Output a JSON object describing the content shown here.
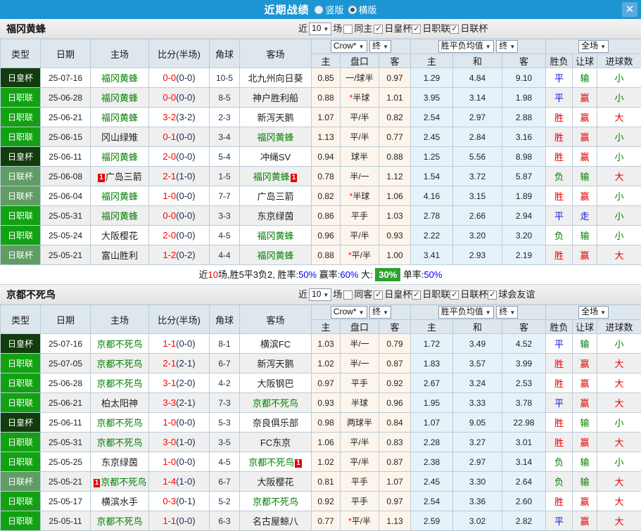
{
  "titlebar": {
    "title": "近期战绩",
    "radio_options": [
      {
        "label": "竖版",
        "selected": false
      },
      {
        "label": "横版",
        "selected": true
      }
    ],
    "close_label": "✕"
  },
  "columns": {
    "main": [
      "类型",
      "日期",
      "主场",
      "比分(半场)",
      "角球",
      "客场"
    ],
    "sub": [
      "主",
      "盘口",
      "客",
      "主",
      "和",
      "客",
      "胜负",
      "让球",
      "进球数"
    ]
  },
  "colors": {
    "type_bg": {
      "日皇杯": "#133c0e",
      "日职联": "#13a113",
      "日联杯": "#619c64"
    },
    "outcome": {
      "胜": "#e60000",
      "平": "#1414dd",
      "负": "#008000",
      "赢": "#e60000",
      "走": "#1414dd",
      "输": "#008000",
      "大": "#e60000",
      "小": "#008000"
    },
    "team_green": "#008000"
  },
  "sections": [
    {
      "team": "福冈黄蜂",
      "filter": {
        "prefix": "近",
        "count": "10",
        "suffix": "场",
        "scope": {
          "label": "同主",
          "checked": false
        },
        "leagues": [
          {
            "label": "日皇杯",
            "checked": true
          },
          {
            "label": "日职联",
            "checked": true
          },
          {
            "label": "日联杯",
            "checked": true
          }
        ]
      },
      "dropdowns": {
        "odds_source": "Crow*",
        "odds_state": "终",
        "avg_label": "胜平负均值",
        "avg_state": "终",
        "period": "全场"
      },
      "rows": [
        {
          "type": "日皇杯",
          "date": "25-07-16",
          "home": "福冈黄蜂",
          "home_badge": "",
          "score": "0-0",
          "half": "(0-0)",
          "corners": "10-5",
          "away": "北九州向日葵",
          "away_badge": "",
          "home_odds": "0.85",
          "handicap": "一/球半",
          "away_odds": "0.97",
          "avg_home": "1.29",
          "avg_draw": "4.84",
          "avg_away": "9.10",
          "result": "平",
          "handicap_result": "输",
          "goals": "小"
        },
        {
          "type": "日职联",
          "date": "25-06-28",
          "home": "福冈黄蜂",
          "home_badge": "",
          "score": "0-0",
          "half": "(0-0)",
          "corners": "8-5",
          "away": "神户胜利船",
          "away_badge": "",
          "home_odds": "0.88",
          "handicap": "*半球",
          "away_odds": "1.01",
          "avg_home": "3.95",
          "avg_draw": "3.14",
          "avg_away": "1.98",
          "result": "平",
          "handicap_result": "赢",
          "goals": "小"
        },
        {
          "type": "日职联",
          "date": "25-06-21",
          "home": "福冈黄蜂",
          "home_badge": "",
          "score": "3-2",
          "half": "(3-2)",
          "corners": "2-3",
          "away": "新泻天鹅",
          "away_badge": "",
          "home_odds": "1.07",
          "handicap": "平/半",
          "away_odds": "0.82",
          "avg_home": "2.54",
          "avg_draw": "2.97",
          "avg_away": "2.88",
          "result": "胜",
          "handicap_result": "赢",
          "goals": "大"
        },
        {
          "type": "日职联",
          "date": "25-06-15",
          "home": "冈山绿雉",
          "home_badge": "",
          "score": "0-1",
          "half": "(0-0)",
          "corners": "3-4",
          "away": "福冈黄蜂",
          "away_badge": "",
          "home_odds": "1.13",
          "handicap": "平/半",
          "away_odds": "0.77",
          "avg_home": "2.45",
          "avg_draw": "2.84",
          "avg_away": "3.16",
          "result": "胜",
          "handicap_result": "赢",
          "goals": "小"
        },
        {
          "type": "日皇杯",
          "date": "25-06-11",
          "home": "福冈黄蜂",
          "home_badge": "",
          "score": "2-0",
          "half": "(0-0)",
          "corners": "5-4",
          "away": "冲绳SV",
          "away_badge": "",
          "home_odds": "0.94",
          "handicap": "球半",
          "away_odds": "0.88",
          "avg_home": "1.25",
          "avg_draw": "5.56",
          "avg_away": "8.98",
          "result": "胜",
          "handicap_result": "赢",
          "goals": "小"
        },
        {
          "type": "日联杯",
          "date": "25-06-08",
          "home": "广岛三箭",
          "home_badge": "1",
          "score": "2-1",
          "half": "(1-0)",
          "corners": "1-5",
          "away": "福冈黄蜂",
          "away_badge": "1",
          "home_odds": "0.78",
          "handicap": "半/一",
          "away_odds": "1.12",
          "avg_home": "1.54",
          "avg_draw": "3.72",
          "avg_away": "5.87",
          "result": "负",
          "handicap_result": "输",
          "goals": "大"
        },
        {
          "type": "日联杯",
          "date": "25-06-04",
          "home": "福冈黄蜂",
          "home_badge": "",
          "score": "1-0",
          "half": "(0-0)",
          "corners": "7-7",
          "away": "广岛三箭",
          "away_badge": "",
          "home_odds": "0.82",
          "handicap": "*半球",
          "away_odds": "1.06",
          "avg_home": "4.16",
          "avg_draw": "3.15",
          "avg_away": "1.89",
          "result": "胜",
          "handicap_result": "赢",
          "goals": "小"
        },
        {
          "type": "日职联",
          "date": "25-05-31",
          "home": "福冈黄蜂",
          "home_badge": "",
          "score": "0-0",
          "half": "(0-0)",
          "corners": "3-3",
          "away": "东京绿茵",
          "away_badge": "",
          "home_odds": "0.86",
          "handicap": "平手",
          "away_odds": "1.03",
          "avg_home": "2.78",
          "avg_draw": "2.66",
          "avg_away": "2.94",
          "result": "平",
          "handicap_result": "走",
          "goals": "小"
        },
        {
          "type": "日职联",
          "date": "25-05-24",
          "home": "大阪樱花",
          "home_badge": "",
          "score": "2-0",
          "half": "(0-0)",
          "corners": "4-5",
          "away": "福冈黄蜂",
          "away_badge": "",
          "home_odds": "0.96",
          "handicap": "平/半",
          "away_odds": "0.93",
          "avg_home": "2.22",
          "avg_draw": "3.20",
          "avg_away": "3.20",
          "result": "负",
          "handicap_result": "输",
          "goals": "小"
        },
        {
          "type": "日联杯",
          "date": "25-05-21",
          "home": "富山胜利",
          "home_badge": "",
          "score": "1-2",
          "half": "(0-2)",
          "corners": "4-4",
          "away": "福冈黄蜂",
          "away_badge": "",
          "home_odds": "0.88",
          "handicap": "*平/半",
          "away_odds": "1.00",
          "avg_home": "3.41",
          "avg_draw": "2.93",
          "avg_away": "2.19",
          "result": "胜",
          "handicap_result": "赢",
          "goals": "大"
        }
      ],
      "summary": [
        {
          "text": "近",
          "style": "plain"
        },
        {
          "text": "10",
          "style": "red"
        },
        {
          "text": "场,胜5平3负2, 胜率:",
          "style": "plain"
        },
        {
          "text": "50%",
          "style": "blue"
        },
        {
          "text": " 赢率:",
          "style": "plain"
        },
        {
          "text": "60%",
          "style": "blue"
        },
        {
          "text": " 大: ",
          "style": "plain"
        },
        {
          "text": "30%",
          "style": "greenbox"
        },
        {
          "text": " 单率:",
          "style": "plain"
        },
        {
          "text": "50%",
          "style": "blue"
        }
      ]
    },
    {
      "team": "京都不死鸟",
      "filter": {
        "prefix": "近",
        "count": "10",
        "suffix": "场",
        "scope": {
          "label": "同客",
          "checked": false
        },
        "leagues": [
          {
            "label": "日皇杯",
            "checked": true
          },
          {
            "label": "日职联",
            "checked": true
          },
          {
            "label": "日联杯",
            "checked": true
          },
          {
            "label": "球会友谊",
            "checked": true
          }
        ]
      },
      "dropdowns": {
        "odds_source": "Crow*",
        "odds_state": "终",
        "avg_label": "胜平负均值",
        "avg_state": "终",
        "period": "全场"
      },
      "rows": [
        {
          "type": "日皇杯",
          "date": "25-07-16",
          "home": "京都不死鸟",
          "home_badge": "",
          "score": "1-1",
          "half": "(0-0)",
          "corners": "8-1",
          "away": "横滨FC",
          "away_badge": "",
          "home_odds": "1.03",
          "handicap": "半/一",
          "away_odds": "0.79",
          "avg_home": "1.72",
          "avg_draw": "3.49",
          "avg_away": "4.52",
          "result": "平",
          "handicap_result": "输",
          "goals": "小"
        },
        {
          "type": "日职联",
          "date": "25-07-05",
          "home": "京都不死鸟",
          "home_badge": "",
          "score": "2-1",
          "half": "(2-1)",
          "corners": "6-7",
          "away": "新泻天鹅",
          "away_badge": "",
          "home_odds": "1.02",
          "handicap": "半/一",
          "away_odds": "0.87",
          "avg_home": "1.83",
          "avg_draw": "3.57",
          "avg_away": "3.99",
          "result": "胜",
          "handicap_result": "赢",
          "goals": "大"
        },
        {
          "type": "日职联",
          "date": "25-06-28",
          "home": "京都不死鸟",
          "home_badge": "",
          "score": "3-1",
          "half": "(2-0)",
          "corners": "4-2",
          "away": "大阪钢巴",
          "away_badge": "",
          "home_odds": "0.97",
          "handicap": "平手",
          "away_odds": "0.92",
          "avg_home": "2.67",
          "avg_draw": "3.24",
          "avg_away": "2.53",
          "result": "胜",
          "handicap_result": "赢",
          "goals": "大"
        },
        {
          "type": "日职联",
          "date": "25-06-21",
          "home": "柏太阳神",
          "home_badge": "",
          "score": "3-3",
          "half": "(2-1)",
          "corners": "7-3",
          "away": "京都不死鸟",
          "away_badge": "",
          "home_odds": "0.93",
          "handicap": "半球",
          "away_odds": "0.96",
          "avg_home": "1.95",
          "avg_draw": "3.33",
          "avg_away": "3.78",
          "result": "平",
          "handicap_result": "赢",
          "goals": "大"
        },
        {
          "type": "日皇杯",
          "date": "25-06-11",
          "home": "京都不死鸟",
          "home_badge": "",
          "score": "1-0",
          "half": "(0-0)",
          "corners": "5-3",
          "away": "奈良俱乐部",
          "away_badge": "",
          "home_odds": "0.98",
          "handicap": "两球半",
          "away_odds": "0.84",
          "avg_home": "1.07",
          "avg_draw": "9.05",
          "avg_away": "22.98",
          "result": "胜",
          "handicap_result": "输",
          "goals": "小"
        },
        {
          "type": "日职联",
          "date": "25-05-31",
          "home": "京都不死鸟",
          "home_badge": "",
          "score": "3-0",
          "half": "(1-0)",
          "corners": "3-5",
          "away": "FC东京",
          "away_badge": "",
          "home_odds": "1.06",
          "handicap": "平/半",
          "away_odds": "0.83",
          "avg_home": "2.28",
          "avg_draw": "3.27",
          "avg_away": "3.01",
          "result": "胜",
          "handicap_result": "赢",
          "goals": "大"
        },
        {
          "type": "日职联",
          "date": "25-05-25",
          "home": "东京绿茵",
          "home_badge": "",
          "score": "1-0",
          "half": "(0-0)",
          "corners": "4-5",
          "away": "京都不死鸟",
          "away_badge": "1",
          "home_odds": "1.02",
          "handicap": "平/半",
          "away_odds": "0.87",
          "avg_home": "2.38",
          "avg_draw": "2.97",
          "avg_away": "3.14",
          "result": "负",
          "handicap_result": "输",
          "goals": "小"
        },
        {
          "type": "日联杯",
          "date": "25-05-21",
          "home": "京都不死鸟",
          "home_badge": "1",
          "score": "1-4",
          "half": "(1-0)",
          "corners": "6-7",
          "away": "大阪樱花",
          "away_badge": "",
          "home_odds": "0.81",
          "handicap": "平手",
          "away_odds": "1.07",
          "avg_home": "2.45",
          "avg_draw": "3.30",
          "avg_away": "2.64",
          "result": "负",
          "handicap_result": "输",
          "goals": "大"
        },
        {
          "type": "日职联",
          "date": "25-05-17",
          "home": "横滨水手",
          "home_badge": "",
          "score": "0-3",
          "half": "(0-1)",
          "corners": "5-2",
          "away": "京都不死鸟",
          "away_badge": "",
          "home_odds": "0.92",
          "handicap": "平手",
          "away_odds": "0.97",
          "avg_home": "2.54",
          "avg_draw": "3.36",
          "avg_away": "2.60",
          "result": "胜",
          "handicap_result": "赢",
          "goals": "大"
        },
        {
          "type": "日职联",
          "date": "25-05-11",
          "home": "京都不死鸟",
          "home_badge": "",
          "score": "1-1",
          "half": "(0-0)",
          "corners": "6-3",
          "away": "名古屋鲸八",
          "away_badge": "",
          "home_odds": "0.77",
          "handicap": "*平/半",
          "away_odds": "1.13",
          "avg_home": "2.59",
          "avg_draw": "3.02",
          "avg_away": "2.82",
          "result": "平",
          "handicap_result": "赢",
          "goals": "大"
        }
      ],
      "summary": null
    }
  ]
}
